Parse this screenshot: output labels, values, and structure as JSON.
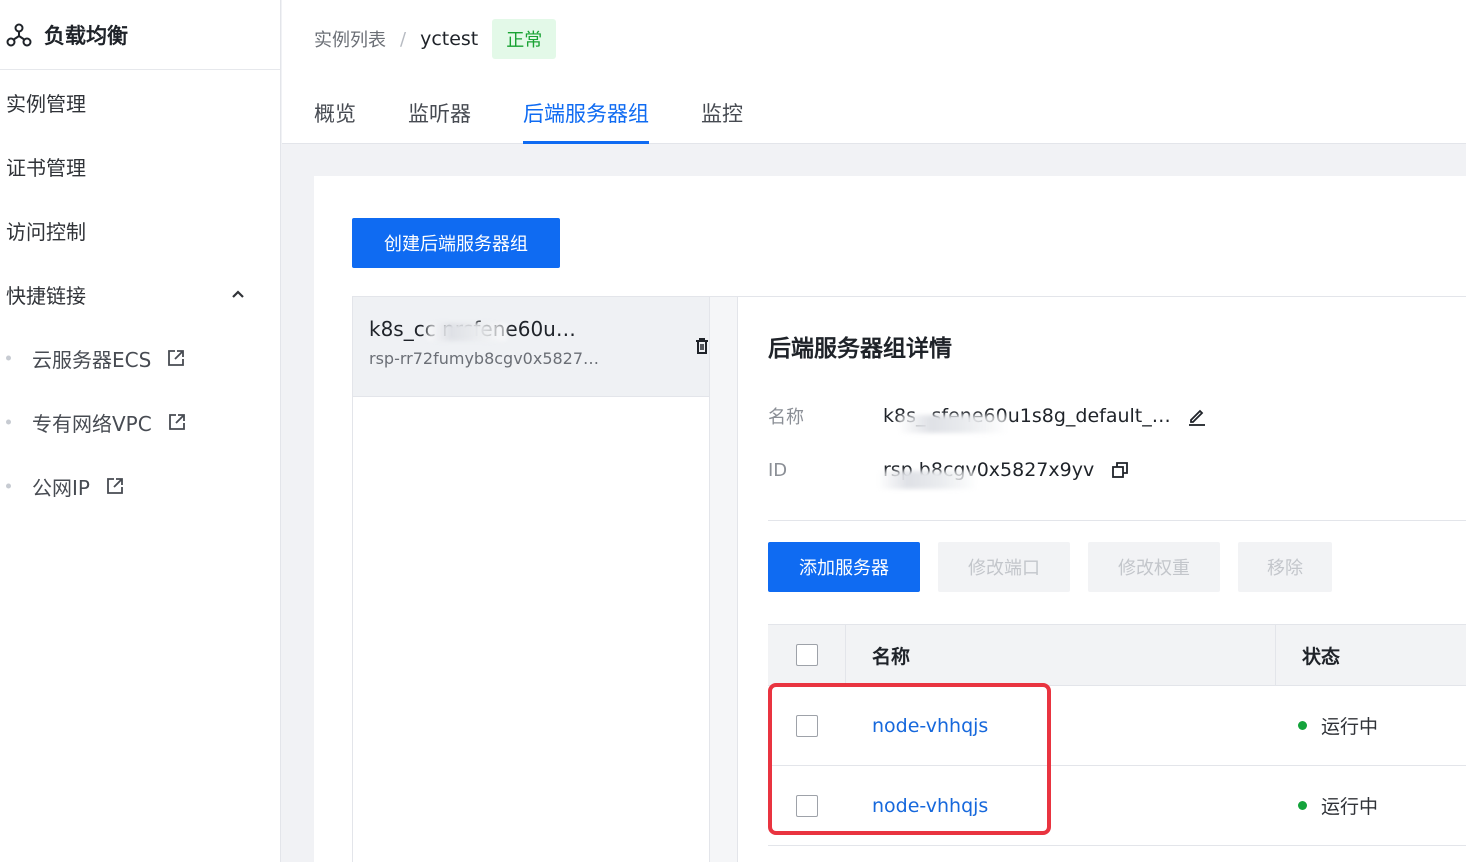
{
  "sidebar": {
    "title": "负载均衡",
    "items": [
      {
        "label": "实例管理"
      },
      {
        "label": "证书管理"
      },
      {
        "label": "访问控制"
      },
      {
        "label": "快捷链接"
      }
    ],
    "links": [
      {
        "label": "云服务器ECS"
      },
      {
        "label": "专有网络VPC"
      },
      {
        "label": "公网IP"
      }
    ]
  },
  "header": {
    "breadcrumb_root": "实例列表",
    "breadcrumb_sep": "/",
    "breadcrumb_current": "yctest",
    "status_badge": "正常",
    "tabs": [
      {
        "label": "概览"
      },
      {
        "label": "监听器"
      },
      {
        "label": "后端服务器组"
      },
      {
        "label": "监控"
      }
    ]
  },
  "main": {
    "create_button": "创建后端服务器组",
    "group_list": [
      {
        "name": "k8s_cc        nrsfene60u…",
        "id": "rsp-rr72fumyb8cgv0x5827…"
      }
    ],
    "detail": {
      "title": "后端服务器组详情",
      "name_label": "名称",
      "name_value": "k8s_             sfene60u1s8g_default_…",
      "id_label": "ID",
      "id_value": "rsp             b8cgv0x5827x9yv"
    },
    "actions": {
      "add": "添加服务器",
      "modify_port": "修改端口",
      "modify_weight": "修改权重",
      "remove": "移除"
    },
    "table": {
      "columns": {
        "name": "名称",
        "status": "状态"
      },
      "rows": [
        {
          "name": "node-vhhqjs",
          "status": "运行中"
        },
        {
          "name": "node-vhhqjs",
          "status": "运行中"
        }
      ]
    }
  },
  "colors": {
    "accent": "#0f6bf2",
    "status_running": "#14a33b",
    "badge_bg": "#e3f9e8",
    "badge_text": "#19a233",
    "highlight": "#e93440"
  }
}
